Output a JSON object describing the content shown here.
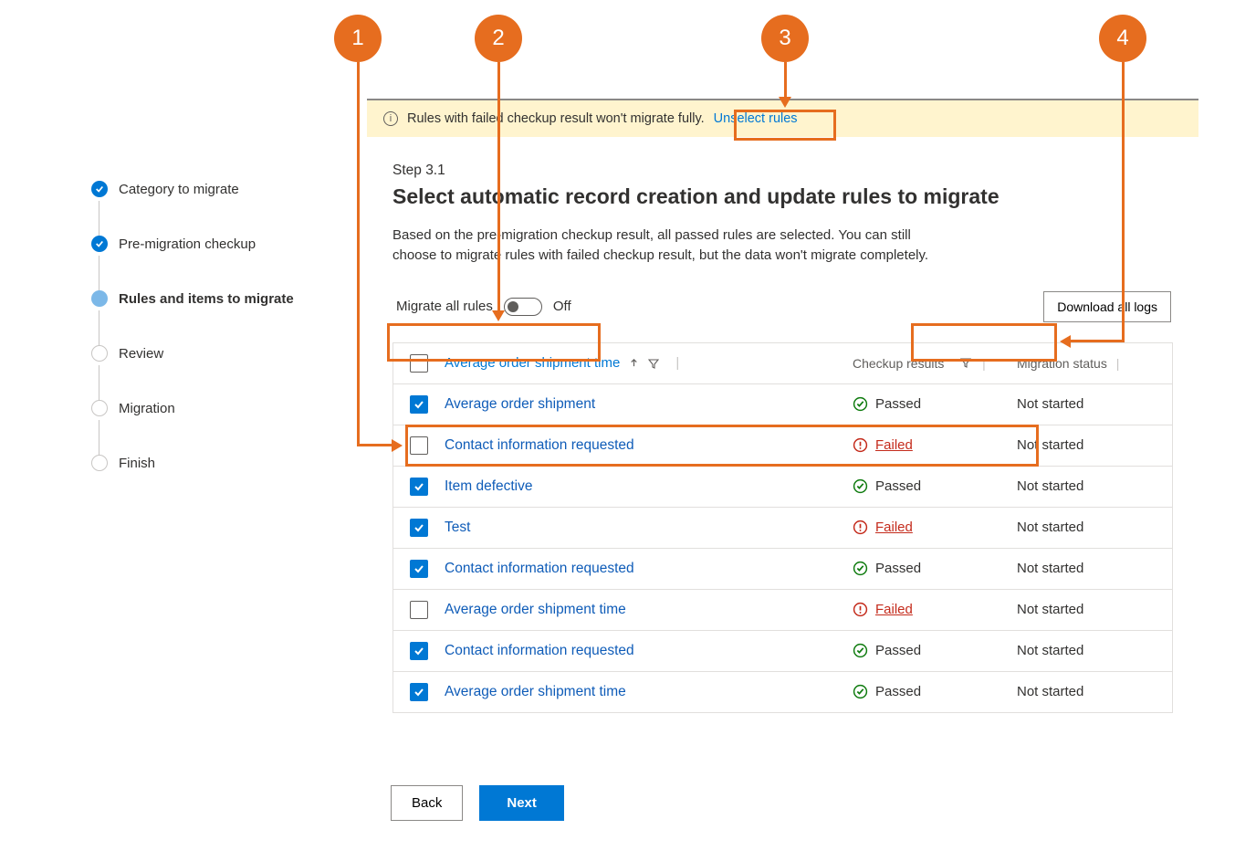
{
  "sidebar": {
    "steps": [
      {
        "label": "Category to migrate",
        "state": "done"
      },
      {
        "label": "Pre-migration checkup",
        "state": "done"
      },
      {
        "label": "Rules and items to migrate",
        "state": "current"
      },
      {
        "label": "Review",
        "state": "pending"
      },
      {
        "label": "Migration",
        "state": "pending"
      },
      {
        "label": "Finish",
        "state": "pending"
      }
    ]
  },
  "info_bar": {
    "text": "Rules with failed checkup result won't migrate fully.",
    "link": "Unselect rules"
  },
  "step": {
    "number": "Step 3.1",
    "title": "Select automatic record creation and update rules to migrate",
    "description": "Based on the pre-migration checkup result, all passed rules are selected. You can still choose to migrate rules with failed checkup result, but the data won't migrate completely."
  },
  "toolbar": {
    "toggle_label": "Migrate all rules",
    "toggle_state": "Off",
    "download_label": "Download all logs"
  },
  "grid": {
    "headers": {
      "name": "Average order shipment time",
      "checkup": "Checkup results",
      "migration": "Migration status"
    },
    "rows": [
      {
        "checked": true,
        "name": "Average order shipment",
        "result": "Passed",
        "status": "Not started"
      },
      {
        "checked": false,
        "name": "Contact information requested",
        "result": "Failed",
        "status": "Not started"
      },
      {
        "checked": true,
        "name": "Item defective",
        "result": "Passed",
        "status": "Not started"
      },
      {
        "checked": true,
        "name": "Test",
        "result": "Failed",
        "status": "Not started"
      },
      {
        "checked": true,
        "name": "Contact information requested",
        "result": "Passed",
        "status": "Not started"
      },
      {
        "checked": false,
        "name": "Average order shipment time",
        "result": "Failed",
        "status": "Not started"
      },
      {
        "checked": true,
        "name": "Contact information requested",
        "result": "Passed",
        "status": "Not started"
      },
      {
        "checked": true,
        "name": "Average order shipment time",
        "result": "Passed",
        "status": "Not started"
      }
    ]
  },
  "footer": {
    "back": "Back",
    "next": "Next"
  },
  "callouts": {
    "c1": "1",
    "c2": "2",
    "c3": "3",
    "c4": "4"
  }
}
